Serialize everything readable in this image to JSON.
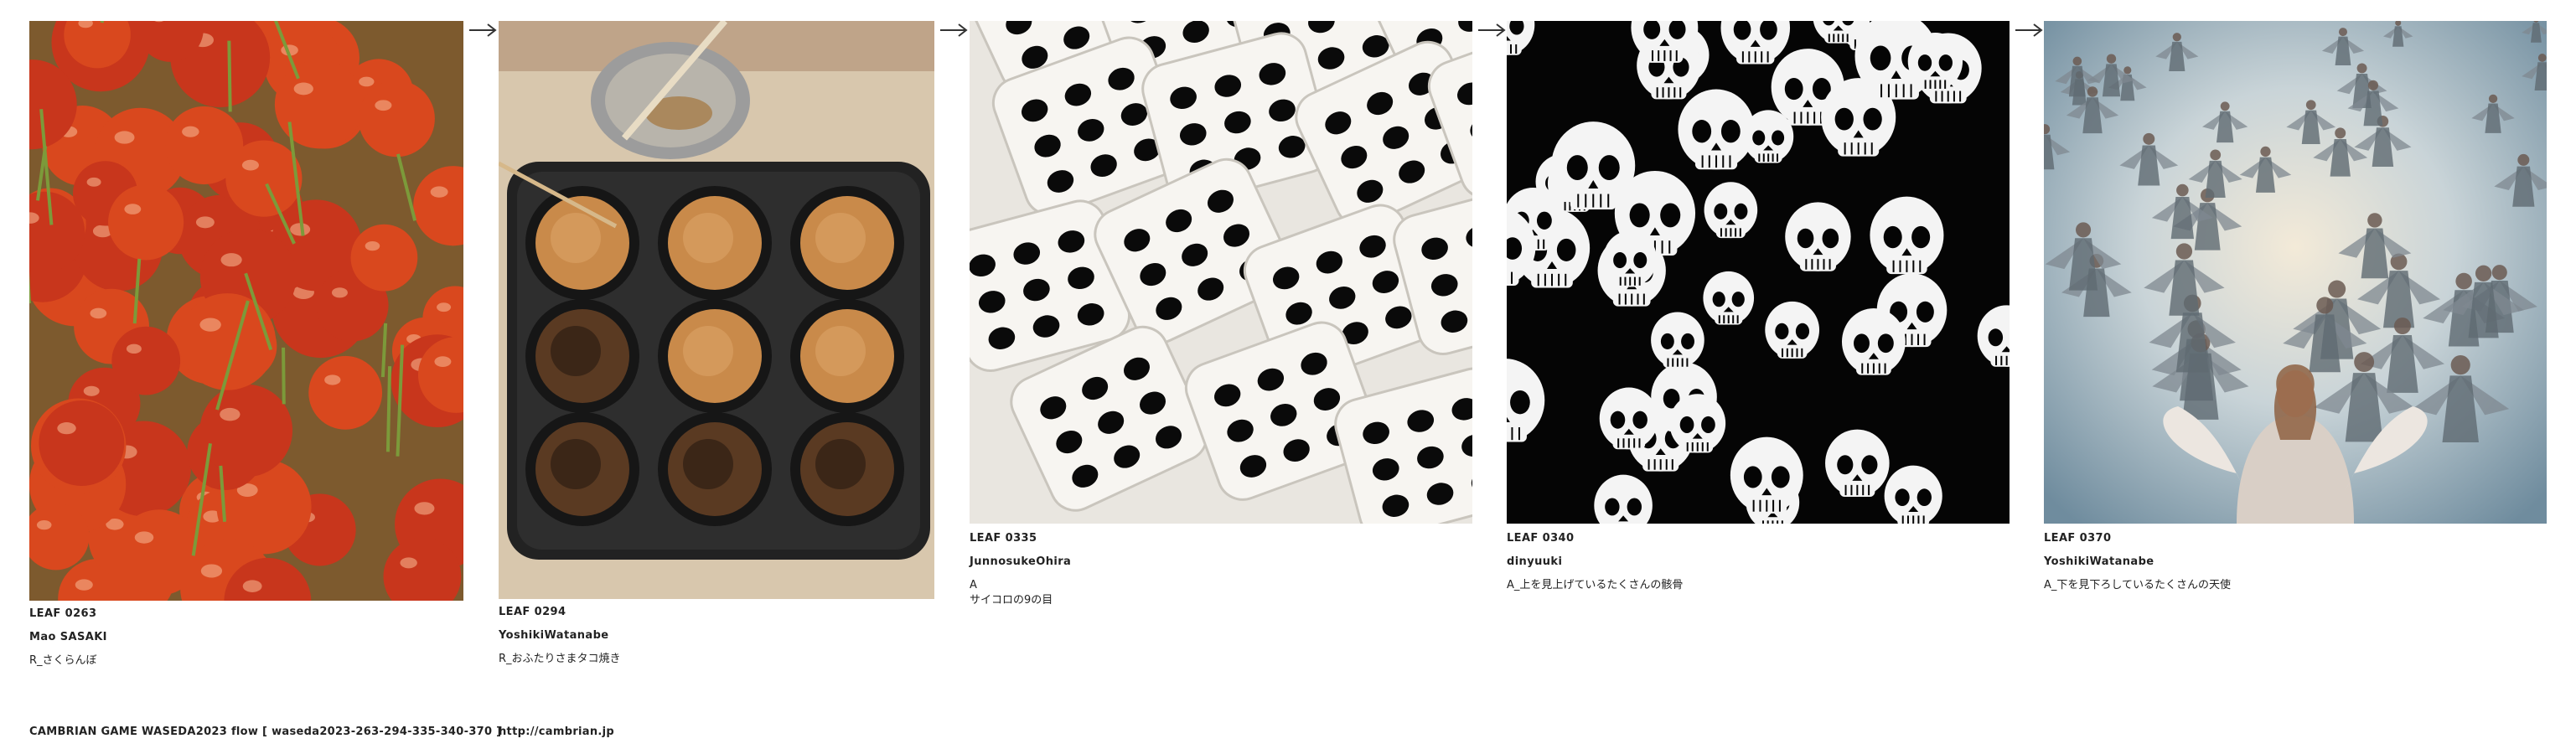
{
  "leaves": [
    {
      "id": "LEAF 0263",
      "author": "Mao SASAKI",
      "caption": "R_さくらんぼ",
      "image_icon": "cherries-photo"
    },
    {
      "id": "LEAF 0294",
      "author": "YoshikiWatanabe",
      "caption": "R_おふたりさまタコ焼き",
      "image_icon": "takoyaki-photo"
    },
    {
      "id": "LEAF 0335",
      "author": "JunnosukeOhira",
      "caption": "A",
      "caption2": "サイコロの9の目",
      "image_icon": "dice-photo"
    },
    {
      "id": "LEAF 0340",
      "author": "dinyuuki",
      "caption": "A_上を見上げているたくさんの骸骨",
      "image_icon": "skulls-image"
    },
    {
      "id": "LEAF 0370",
      "author": "YoshikiWatanabe",
      "caption": "A_下を見下ろしているたくさんの天使",
      "image_icon": "angels-image"
    }
  ],
  "footer": {
    "title": "CAMBRIAN GAME  WASEDA2023  flow [ waseda2023-263-294-335-340-370 ]",
    "link": "http://cambrian.jp"
  },
  "colors": {
    "cherry": "#c8361c",
    "takoyaki_pan": "#2a2a2a",
    "dice": "#f2f0ec",
    "background": "#ffffff"
  }
}
